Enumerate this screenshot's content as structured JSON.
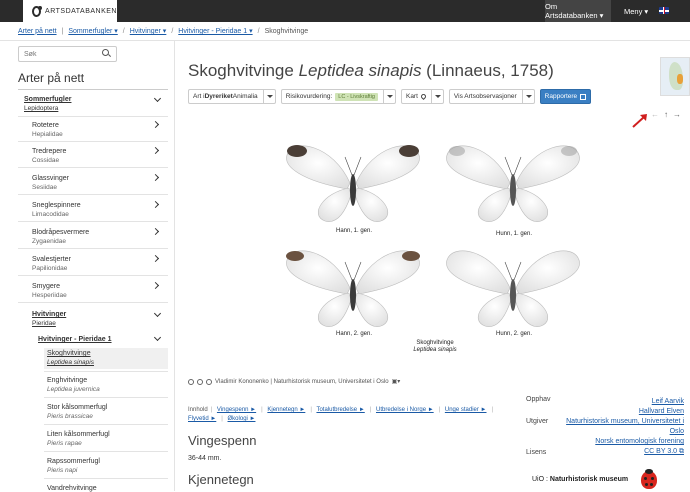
{
  "header": {
    "logo_text": "ARTSDATABANKEN",
    "nav": [
      {
        "label": "Om Artsdatabanken ▾"
      },
      {
        "label": "Meny ▾"
      }
    ]
  },
  "breadcrumb": [
    {
      "label": "Arter på nett"
    },
    {
      "label": "Sommerfugler ▾"
    },
    {
      "label": "Hvitvinger ▾"
    },
    {
      "label": "Hvitvinger - Pieridae 1 ▾"
    },
    {
      "label": "Skoghvitvinge"
    }
  ],
  "search": {
    "placeholder": "Søk"
  },
  "sidebar": {
    "title": "Arter på nett",
    "items": [
      {
        "name": "Sommerfugler",
        "sci": "Lepidoptera"
      },
      {
        "name": "Rotetere",
        "sci": "Hepialidae"
      },
      {
        "name": "Tredrepere",
        "sci": "Cossidae"
      },
      {
        "name": "Glassvinger",
        "sci": "Sesiidae"
      },
      {
        "name": "Sneglespinnere",
        "sci": "Limacodidae"
      },
      {
        "name": "Blodråpesvermere",
        "sci": "Zygaenidae"
      },
      {
        "name": "Svalestjerter",
        "sci": "Papilionidae"
      },
      {
        "name": "Smygere",
        "sci": "Hesperiidae"
      },
      {
        "name": "Hvitvinger",
        "sci": "Pieridae"
      },
      {
        "name": "Hvitvinger - Pieridae 1",
        "sci": ""
      },
      {
        "name": "Skoghvitvinge",
        "sci": "Leptidea sinapis"
      },
      {
        "name": "Enghvitvinge",
        "sci": "Leptidea juvernica"
      },
      {
        "name": "Stor kålsommerfugl",
        "sci": "Pieris brassicae"
      },
      {
        "name": "Liten kålsommerfugl",
        "sci": "Pieris rapae"
      },
      {
        "name": "Rapssommerfugl",
        "sci": "Pieris napi"
      },
      {
        "name": "Vandrehvitvinge",
        "sci": ""
      }
    ]
  },
  "page": {
    "title_common": "Skoghvitvinge ",
    "title_sci": "Leptidea sinapis",
    "title_author": " (Linnaeus, 1758)"
  },
  "buttons": {
    "art_prefix": "Art i ",
    "art_kingdom": "Dyreriket",
    "art_group": " Animalia",
    "risk_label": "Risikovurdering:",
    "risk_badge": "LC - Livskraftig",
    "map": "Kart",
    "observations": "Vis Artsobservasjoner",
    "report": "Rapportere"
  },
  "nav_arrows": {
    "prev": "←",
    "up": "↑",
    "next": "→"
  },
  "accent_colors": {
    "primary_button": "#3a7fc3",
    "lc_badge": "#cfe3b5",
    "link": "#1a5aa6",
    "red_arrow": "#d01f1f"
  },
  "plate": {
    "labels": [
      "Hann, 1. gen.",
      "Hunn, 1. gen.",
      "Hann, 2. gen.",
      "Hunn, 2. gen."
    ],
    "caption_common": "Skoghvitvinge",
    "caption_sci": "Leptidea sinapis"
  },
  "credit": {
    "text": "Vladimir Kononenko | Naturhistorisk museum, Universitetet i Oslo"
  },
  "toc": {
    "label": "Innhold",
    "links": [
      "Vingespenn ►",
      "Kjennetegn ►",
      "Totalutbredelse ►",
      "Utbredelse i Norge ►",
      "Unge stadier ►",
      "Flyvetid ►",
      "Økologi ►"
    ]
  },
  "sections": {
    "wingspan_heading": "Vingespenn",
    "wingspan_text": "36-44 mm.",
    "features_heading": "Kjennetegn"
  },
  "meta": {
    "origin_label": "Opphav",
    "origin_value": "Leif Aarvik",
    "origin_value2": "Hallvard Elven",
    "publisher_label": "Utgiver",
    "publisher_value": "Naturhistorisk museum, Universitetet i",
    "publisher_value2": "Oslo",
    "publisher_value3": "Norsk entomologisk forening",
    "license_label": "Lisens",
    "license_value": "CC BY 3.0 ⧉",
    "uio_label": "UiO : ",
    "uio_name": "Naturhistorisk museum"
  }
}
